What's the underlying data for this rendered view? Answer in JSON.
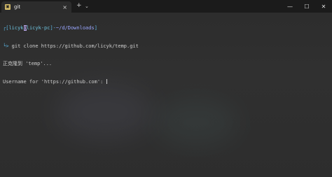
{
  "tab": {
    "icon": "terminal-icon",
    "title": "git",
    "close": "×"
  },
  "titlebar": {
    "new_tab": "+",
    "dropdown": "⌄",
    "minimize": "—",
    "maximize": "☐",
    "close": "✕"
  },
  "terminal": {
    "prompt_open": "┌[",
    "user": "licyk",
    "at": "@",
    "host": "licyk-pc",
    "sep": "]-",
    "path": "~/d/Downloads",
    "prompt_close": "]",
    "arrow": "└>",
    "command": " git clone https://github.com/licyk/temp.git",
    "out1": "正克隆到 'temp'...",
    "out2": "Username for 'https://github.com': "
  }
}
